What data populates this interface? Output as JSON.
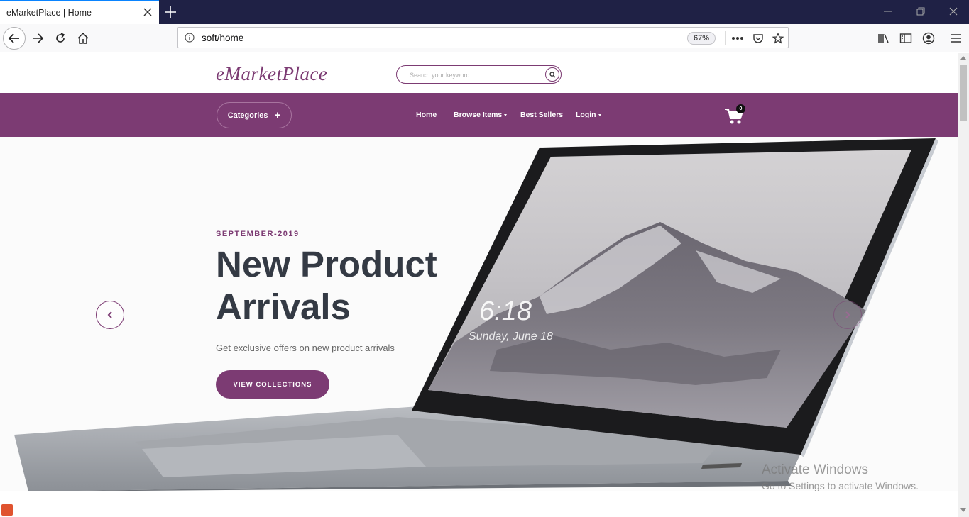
{
  "browser": {
    "tab_title": "eMarketPlace | Home",
    "url": "soft/home",
    "zoom": "67%"
  },
  "site": {
    "logo": "eMarketPlace",
    "search_placeholder": "Search your keyword",
    "categories_label": "Categories",
    "nav": {
      "home": "Home",
      "browse": "Browse Items",
      "best_sellers": "Best Sellers",
      "login": "Login"
    },
    "cart_count": "0"
  },
  "hero": {
    "date": "SEPTEMBER-2019",
    "title": "New Product Arrivals",
    "subtitle": "Get exclusive offers on new product arrivals",
    "cta": "VIEW COLLECTIONS",
    "screen_time": "6:18",
    "screen_date": "Sunday, June 18"
  },
  "watermark": {
    "title": "Activate Windows",
    "subtitle": "Go to Settings to activate Windows."
  },
  "colors": {
    "brand": "#7c3b73",
    "tab_bar": "#1f2145",
    "headline": "#343a44"
  }
}
